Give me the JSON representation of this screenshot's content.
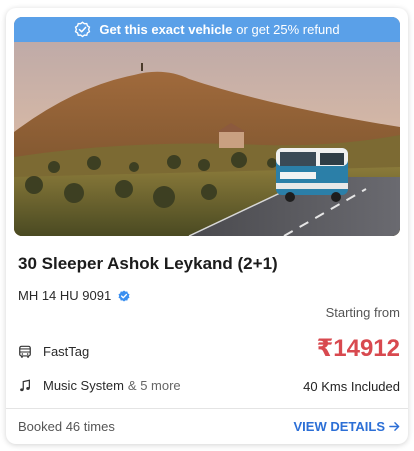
{
  "banner": {
    "bold_text": "Get this exact vehicle",
    "rest_text": "or get 25% refund",
    "icon": "verified-check-icon"
  },
  "photo": {
    "description_icon": "bus-photo"
  },
  "vehicle": {
    "title": "30 Sleeper Ashok Leykand (2+1)",
    "plate": "MH 14 HU 9091",
    "verified_icon": "verified-badge-icon"
  },
  "pricing": {
    "starting_label": "Starting from",
    "price": "₹14912",
    "kms": "40 Kms Included"
  },
  "features": [
    {
      "icon": "bus-icon",
      "label": "FastTag",
      "more": ""
    },
    {
      "icon": "music-note-icon",
      "label": "Music System",
      "more": "& 5 more"
    }
  ],
  "footer": {
    "booked": "Booked 46 times",
    "view_details": "VIEW DETAILS",
    "arrow_icon": "arrow-right-icon"
  },
  "colors": {
    "banner": "#5aa0e8",
    "price": "#d8494f",
    "link": "#2c6fd6"
  }
}
